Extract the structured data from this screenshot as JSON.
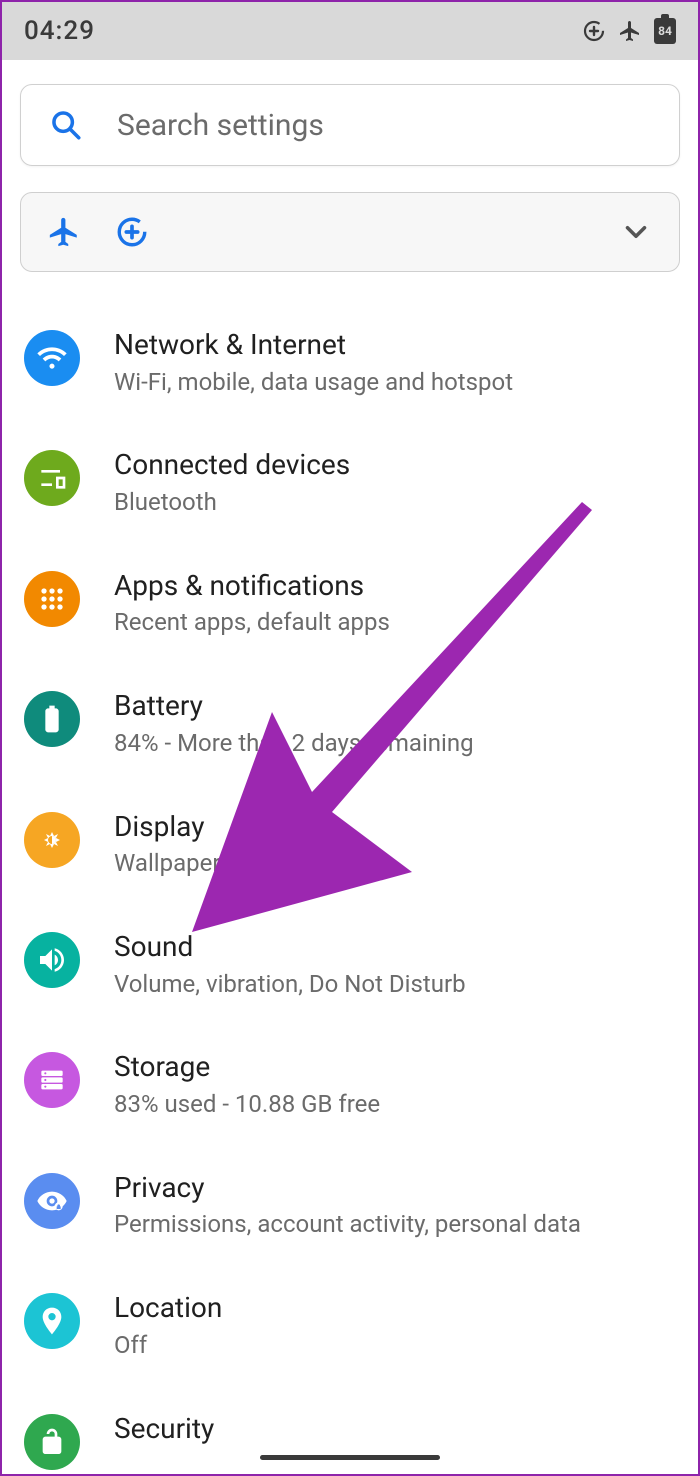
{
  "statusbar": {
    "time": "04:29",
    "battery_pct": "84"
  },
  "search": {
    "placeholder": "Search settings"
  },
  "colors": {
    "network": "#1a8df1",
    "connected": "#6eaa1d",
    "apps": "#f28900",
    "battery": "#0f8b7c",
    "display": "#f6a623",
    "sound": "#07b2a0",
    "storage": "#c658e0",
    "privacy": "#5a8df0",
    "location": "#1cc4d4",
    "security": "#2fa84f",
    "arrow": "#9c27b0",
    "quick_icon": "#1a73e8"
  },
  "items": [
    {
      "id": "network",
      "title": "Network & Internet",
      "sub": "Wi-Fi, mobile, data usage and hotspot"
    },
    {
      "id": "connected",
      "title": "Connected devices",
      "sub": "Bluetooth"
    },
    {
      "id": "apps",
      "title": "Apps & notifications",
      "sub": "Recent apps, default apps"
    },
    {
      "id": "battery",
      "title": "Battery",
      "sub": "84% - More than 2 days remaining"
    },
    {
      "id": "display",
      "title": "Display",
      "sub": "Wallpaper, sleep, font size"
    },
    {
      "id": "sound",
      "title": "Sound",
      "sub": "Volume, vibration, Do Not Disturb"
    },
    {
      "id": "storage",
      "title": "Storage",
      "sub": "83% used - 10.88 GB free"
    },
    {
      "id": "privacy",
      "title": "Privacy",
      "sub": "Permissions, account activity, personal data"
    },
    {
      "id": "location",
      "title": "Location",
      "sub": "Off"
    },
    {
      "id": "security",
      "title": "Security",
      "sub": ""
    }
  ]
}
